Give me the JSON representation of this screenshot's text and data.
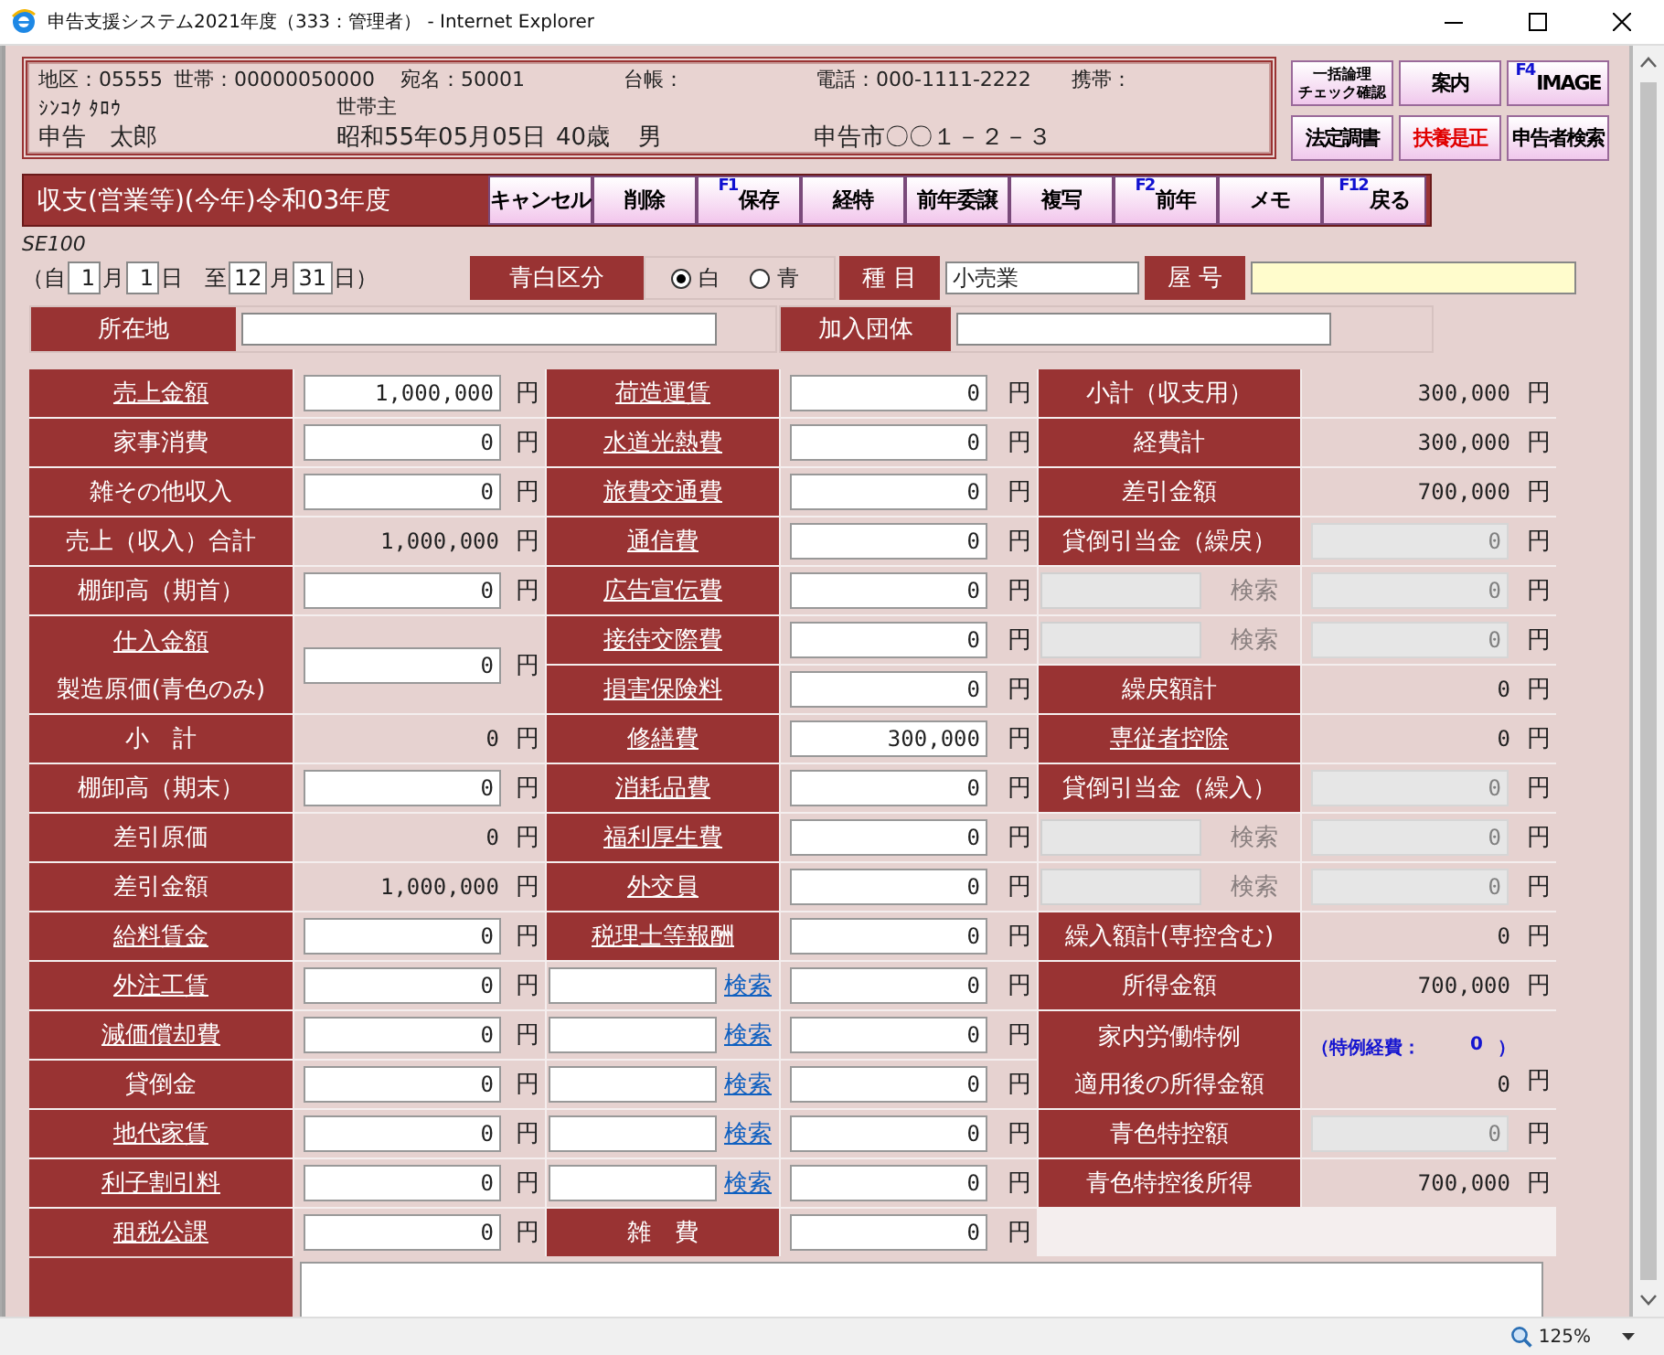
{
  "window": {
    "title": "申告支援システム2021年度（333：管理者） - Internet Explorer"
  },
  "header": {
    "rows": [
      [
        {
          "text": "地区：05555"
        },
        {
          "text": "世帯：00000050000"
        },
        {
          "text": "宛名：50001"
        },
        {
          "text": "台帳："
        },
        {
          "text": "電話：000-1111-2222"
        },
        {
          "text": "携帯："
        }
      ],
      [
        {
          "text": "ｼﾝｺｸ ﾀﾛｳ"
        },
        {
          "text": "世帯主"
        }
      ],
      [
        {
          "text": "申告　太郎"
        },
        {
          "text": "昭和55年05月05日"
        },
        {
          "text": "40歳"
        },
        {
          "text": "男"
        },
        {
          "text": "申告市〇〇１－２－３"
        }
      ]
    ]
  },
  "quick_buttons": [
    {
      "lines": [
        "一括論理",
        "チェック確認"
      ],
      "kind": "small"
    },
    {
      "label": "案内",
      "kind": "plain"
    },
    {
      "key": "F4",
      "label": "IMAGE",
      "kind": "plain"
    },
    {
      "label": "法定調書",
      "kind": "plain"
    },
    {
      "label": "扶養是正",
      "kind": "alert"
    },
    {
      "label": "申告者検索",
      "kind": "plain"
    }
  ],
  "toolbar": {
    "title": "収支(営業等)(今年)令和03年度",
    "buttons": [
      {
        "label": "キャンセル"
      },
      {
        "label": "削除"
      },
      {
        "key": "F1",
        "label": "保存"
      },
      {
        "label": "経特"
      },
      {
        "label": "前年委譲"
      },
      {
        "label": "複写"
      },
      {
        "key": "F2",
        "label": "前年"
      },
      {
        "label": "メモ"
      },
      {
        "key": "F12",
        "label": "戻る"
      }
    ]
  },
  "form_code": "SE100",
  "period": {
    "open": "（自",
    "from_month": "1",
    "month_1": "月",
    "from_day": "1",
    "day_1": "日　至",
    "to_month": "12",
    "month_2": "月",
    "to_day": "31",
    "close": "日）"
  },
  "filing_type": {
    "label": "青白区分",
    "options": [
      {
        "label": "白",
        "selected": true
      },
      {
        "label": "青",
        "selected": false
      }
    ]
  },
  "category": {
    "label": "種 目",
    "value": "小売業"
  },
  "trade_name": {
    "label": "屋 号"
  },
  "address": {
    "label": "所在地"
  },
  "association": {
    "label": "加入団体"
  },
  "columns": [
    [
      {
        "kind": "input",
        "label": "売上金額",
        "link": true,
        "value": "1,000,000",
        "unit": "円",
        "disabled": false
      },
      {
        "kind": "input",
        "label": "家事消費",
        "link": false,
        "value": "0",
        "unit": "円",
        "disabled": false
      },
      {
        "kind": "input",
        "label": "雑その他収入",
        "link": false,
        "value": "0",
        "unit": "円",
        "disabled": false
      },
      {
        "kind": "readout",
        "label": "売上（収入）合計",
        "link": false,
        "value": "1,000,000",
        "unit": "円"
      },
      {
        "kind": "input",
        "label": "棚卸高（期首）",
        "link": false,
        "value": "0",
        "unit": "円",
        "disabled": false
      },
      {
        "kind": "stacked",
        "lines": [
          {
            "text": "仕入金額",
            "link": true
          },
          {
            "text": "製造原価(青色のみ)",
            "link": false
          }
        ],
        "value": "0",
        "unit": "円",
        "disabled": false
      },
      {
        "kind": "readout",
        "label": "小　計",
        "link": false,
        "value": "0",
        "unit": "円"
      },
      {
        "kind": "input",
        "label": "棚卸高（期末）",
        "link": false,
        "value": "0",
        "unit": "円",
        "disabled": false
      },
      {
        "kind": "readout",
        "label": "差引原価",
        "link": false,
        "value": "0",
        "unit": "円"
      },
      {
        "kind": "readout",
        "label": "差引金額",
        "link": false,
        "value": "1,000,000",
        "unit": "円"
      },
      {
        "kind": "input",
        "label": "給料賃金",
        "link": true,
        "value": "0",
        "unit": "円",
        "disabled": false
      },
      {
        "kind": "input",
        "label": "外注工賃",
        "link": true,
        "value": "0",
        "unit": "円",
        "disabled": false
      },
      {
        "kind": "input",
        "label": "減価償却費",
        "link": true,
        "value": "0",
        "unit": "円",
        "disabled": false
      },
      {
        "kind": "input",
        "label": "貸倒金",
        "link": false,
        "value": "0",
        "unit": "円",
        "disabled": false
      },
      {
        "kind": "input",
        "label": "地代家賃",
        "link": true,
        "value": "0",
        "unit": "円",
        "disabled": false
      },
      {
        "kind": "input",
        "label": "利子割引料",
        "link": true,
        "value": "0",
        "unit": "円",
        "disabled": false
      },
      {
        "kind": "input",
        "label": "租税公課",
        "link": true,
        "value": "0",
        "unit": "円",
        "disabled": false
      }
    ],
    [
      {
        "kind": "input",
        "label": "荷造運賃",
        "link": true,
        "value": "0",
        "unit": "円",
        "disabled": false
      },
      {
        "kind": "input",
        "label": "水道光熱費",
        "link": true,
        "value": "0",
        "unit": "円",
        "disabled": false
      },
      {
        "kind": "input",
        "label": "旅費交通費",
        "link": true,
        "value": "0",
        "unit": "円",
        "disabled": false
      },
      {
        "kind": "input",
        "label": "通信費",
        "link": true,
        "value": "0",
        "unit": "円",
        "disabled": false
      },
      {
        "kind": "input",
        "label": "広告宣伝費",
        "link": true,
        "value": "0",
        "unit": "円",
        "disabled": false
      },
      {
        "kind": "input",
        "label": "接待交際費",
        "link": true,
        "value": "0",
        "unit": "円",
        "disabled": false
      },
      {
        "kind": "input",
        "label": "損害保険料",
        "link": true,
        "value": "0",
        "unit": "円",
        "disabled": false
      },
      {
        "kind": "input",
        "label": "修繕費",
        "link": true,
        "value": "300,000",
        "unit": "円",
        "disabled": false
      },
      {
        "kind": "input",
        "label": "消耗品費",
        "link": true,
        "value": "0",
        "unit": "円",
        "disabled": false
      },
      {
        "kind": "input",
        "label": "福利厚生費",
        "link": true,
        "value": "0",
        "unit": "円",
        "disabled": false
      },
      {
        "kind": "input",
        "label": "外交員",
        "link": true,
        "value": "0",
        "unit": "円",
        "disabled": false
      },
      {
        "kind": "input",
        "label": "税理士等報酬",
        "link": true,
        "value": "0",
        "unit": "円",
        "disabled": false
      },
      {
        "kind": "custom",
        "search": "検索",
        "value": "0",
        "unit": "円",
        "disabled": false
      },
      {
        "kind": "custom",
        "search": "検索",
        "value": "0",
        "unit": "円",
        "disabled": false
      },
      {
        "kind": "custom",
        "search": "検索",
        "value": "0",
        "unit": "円",
        "disabled": false
      },
      {
        "kind": "custom",
        "search": "検索",
        "value": "0",
        "unit": "円",
        "disabled": false
      },
      {
        "kind": "custom",
        "search": "検索",
        "value": "0",
        "unit": "円",
        "disabled": false
      },
      {
        "kind": "input",
        "label": "雑　費",
        "link": false,
        "value": "0",
        "unit": "円",
        "disabled": false
      }
    ],
    [
      {
        "kind": "readout",
        "label": "小計（収支用）",
        "link": false,
        "value": "300,000",
        "unit": "円"
      },
      {
        "kind": "readout",
        "label": "経費計",
        "link": false,
        "value": "300,000",
        "unit": "円"
      },
      {
        "kind": "readout",
        "label": "差引金額",
        "link": false,
        "value": "700,000",
        "unit": "円"
      },
      {
        "kind": "input",
        "label": "貸倒引当金（繰戻）",
        "link": false,
        "value": "0",
        "unit": "円",
        "disabled": true
      },
      {
        "kind": "custom",
        "search": "検索",
        "value": "0",
        "unit": "円",
        "disabled": true
      },
      {
        "kind": "custom",
        "search": "検索",
        "value": "0",
        "unit": "円",
        "disabled": true
      },
      {
        "kind": "readout",
        "label": "繰戻額計",
        "link": false,
        "value": "0",
        "unit": "円"
      },
      {
        "kind": "readout",
        "label": "専従者控除",
        "link": true,
        "value": "0",
        "unit": "円"
      },
      {
        "kind": "input",
        "label": "貸倒引当金（繰入）",
        "link": false,
        "value": "0",
        "unit": "円",
        "disabled": true
      },
      {
        "kind": "custom",
        "search": "検索",
        "value": "0",
        "unit": "円",
        "disabled": true
      },
      {
        "kind": "custom",
        "search": "検索",
        "value": "0",
        "unit": "円",
        "disabled": true
      },
      {
        "kind": "readout",
        "label": "繰入額計(専控含む)",
        "link": false,
        "value": "0",
        "unit": "円"
      },
      {
        "kind": "readout",
        "label": "所得金額",
        "link": false,
        "value": "700,000",
        "unit": "円"
      },
      {
        "kind": "special",
        "lines": [
          {
            "text": "家内労働特例",
            "link": false
          },
          {
            "text": "適用後の所得金額",
            "link": false
          }
        ],
        "note_label": "（特例経費：",
        "note_value": "0",
        "note_close": "）",
        "value": "0",
        "unit": "円"
      },
      {
        "kind": "input",
        "label": "青色特控額",
        "link": false,
        "value": "0",
        "unit": "円",
        "disabled": true
      },
      {
        "kind": "readout",
        "label": "青色特控後所得",
        "link": false,
        "value": "700,000",
        "unit": "円"
      }
    ]
  ],
  "status_bar": {
    "zoom": "125%"
  }
}
